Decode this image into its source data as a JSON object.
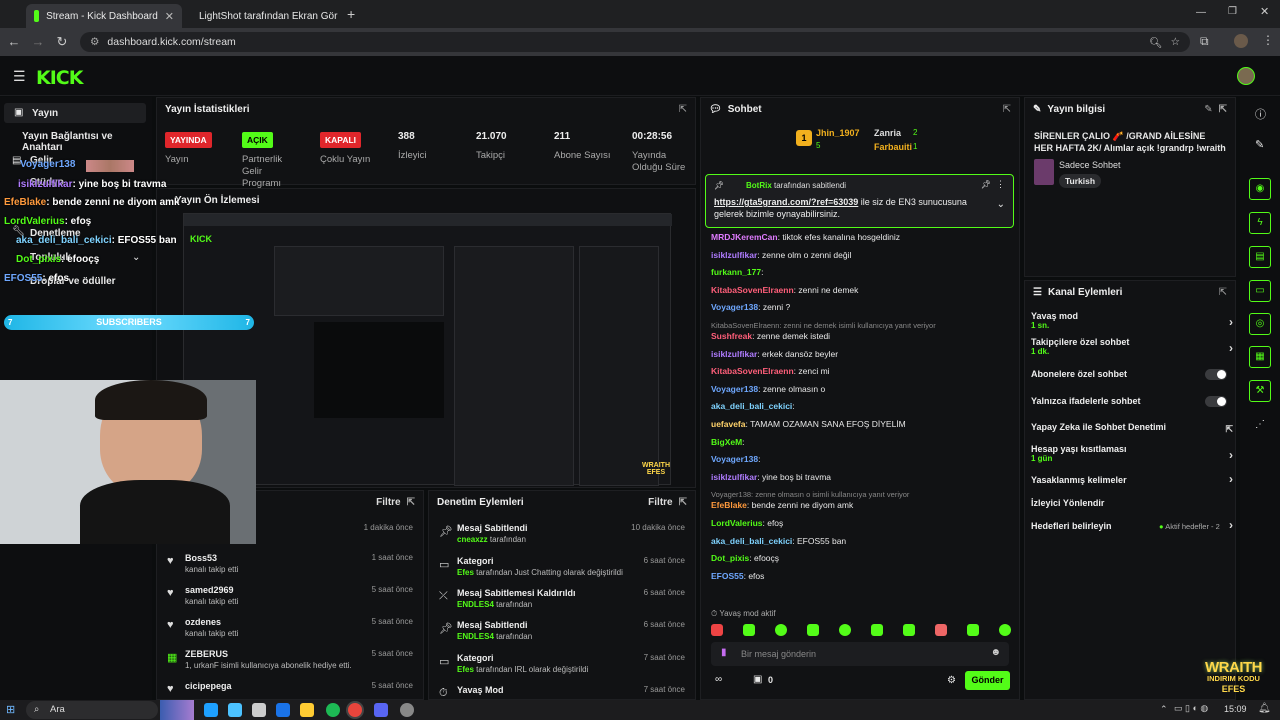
{
  "browser": {
    "tabs": [
      {
        "label": "Stream - Kick Dashboard",
        "active": true
      },
      {
        "label": "LightShot tarafından Ekran Gör",
        "active": false
      }
    ],
    "url": "dashboard.kick.com/stream"
  },
  "colors": {
    "accent": "#53fc18",
    "live_red": "#e0262b",
    "panel_bg": "#111214"
  },
  "sidebar": {
    "items": [
      {
        "label": "Yayın",
        "icon": "video-icon"
      },
      {
        "label": "Yayın Bağlantısı ve Anahtarı",
        "icon": "key-icon"
      },
      {
        "label": "Gelir",
        "icon": "money-icon"
      },
      {
        "label": "Stüdyo",
        "icon": "studio-icon"
      },
      {
        "label": "Denetleme",
        "icon": "shield-icon"
      },
      {
        "label": "Topluluk",
        "icon": "people-icon"
      },
      {
        "label": "Droplar ve ödüller",
        "icon": "gift-icon"
      }
    ]
  },
  "overlay": {
    "chat": [
      {
        "user": "Voyager138",
        "msg": ""
      },
      {
        "user": "isiklzulfikar",
        "msg": ": yine boş bi travma"
      },
      {
        "user": "EfeBlake",
        "msg": ": bende zenni ne diyom amk"
      },
      {
        "user": "LordValerius",
        "msg": ": efoş"
      },
      {
        "user": "aka_deli_bali_cekici",
        "msg": ": EFOS55 ban"
      },
      {
        "user": "Dot_pixis",
        "msg": ": efooçş"
      },
      {
        "user": "EFOS55",
        "msg": ": efos"
      }
    ],
    "subscribers_label": "SUBSCRIBERS",
    "sub_left": "7",
    "sub_right": "7",
    "brand_top": "WRAITH",
    "brand_bottom": "INDIRIM KODU",
    "brand_code": "EFES"
  },
  "stats": {
    "title": "Yayın İstatistikleri",
    "items": [
      {
        "badge": "YAYINDA",
        "label": "Yayın"
      },
      {
        "badge": "AÇIK",
        "label": "Partnerlik Gelir Programı"
      },
      {
        "badge": "KAPALI",
        "label": "Çoklu Yayın"
      },
      {
        "value": "388",
        "label": "İzleyici"
      },
      {
        "value": "21.070",
        "label": "Takipçi"
      },
      {
        "value": "211",
        "label": "Abone Sayısı"
      },
      {
        "value": "00:28:56",
        "label": "Yayında Olduğu Süre"
      }
    ]
  },
  "preview": {
    "title": "Yayın Ön İzlemesi"
  },
  "activity": {
    "filter_label": "Filtre",
    "top_time": "1 dakika önce",
    "rows": [
      {
        "user": "Boss53",
        "desc": "kanalı takip etti",
        "time": "1 saat önce",
        "icon": "heart-icon"
      },
      {
        "user": "samed2969",
        "desc": "kanalı takip etti",
        "time": "5 saat önce",
        "icon": "heart-icon"
      },
      {
        "user": "ozdenes",
        "desc": "kanalı takip etti",
        "time": "5 saat önce",
        "icon": "heart-icon"
      },
      {
        "user": "ZEBERUS",
        "desc": "1, urkanF isimli kullanıcıya abonelik hediye etti.",
        "time": "5 saat önce",
        "icon": "sub-icon"
      },
      {
        "user": "cicipepega",
        "desc": "",
        "time": "5 saat önce",
        "icon": "heart-icon"
      }
    ]
  },
  "modlog": {
    "title": "Denetim Eylemleri",
    "filter_label": "Filtre",
    "rows": [
      {
        "title": "Mesaj Sabitlendi",
        "user": "cneaxzz",
        "rest": " tarafından",
        "time": "10 dakika önce",
        "icon": "pin-icon"
      },
      {
        "title": "Kategori",
        "user": "Efes",
        "rest": " tarafından Just Chatting olarak değiştirildi",
        "time": "6 saat önce",
        "icon": "category-icon"
      },
      {
        "title": "Mesaj Sabitlemesi Kaldırıldı",
        "user": "ENDLES4",
        "rest": " tarafından",
        "time": "6 saat önce",
        "icon": "unpin-icon"
      },
      {
        "title": "Mesaj Sabitlendi",
        "user": "ENDLES4",
        "rest": " tarafından",
        "time": "6 saat önce",
        "icon": "pin-icon"
      },
      {
        "title": "Kategori",
        "user": "Efes",
        "rest": " tarafından IRL olarak değiştirildi",
        "time": "7 saat önce",
        "icon": "category-icon"
      },
      {
        "title": "Yavaş Mod",
        "user": "",
        "rest": "",
        "time": "7 saat önce",
        "icon": "slow-icon"
      }
    ]
  },
  "chat": {
    "title": "Sohbet",
    "top_gifters": [
      {
        "name": "Jhin_1907",
        "count": "5"
      },
      {
        "name": "Zanria",
        "count": "2"
      },
      {
        "name": "Farbauiti",
        "count": "1"
      }
    ],
    "pinned_by": "BotRix",
    "pinned_by_suffix": " tarafından sabitlendi",
    "pinned_link": "https://gta5grand.com/?ref=63039",
    "pinned_text": " ile siz de EN3 sunucusuna gelerek bizimle oynayabilirsiniz.",
    "messages": [
      {
        "user": "MRDJKeremCan",
        "color": "#e07cff",
        "text": ": tiktok efes kanalına hosgeldiniz"
      },
      {
        "user": "isiklzulfikar",
        "color": "#b07cff",
        "text": ": zenne olm o zenni değil"
      },
      {
        "user": "furkann_177",
        "color": "#53fc18",
        "text": ":"
      },
      {
        "user": "KitabaSovenElraenn",
        "color": "#ff5f7a",
        "text": ": zenni ne demek"
      },
      {
        "user": "Voyager138",
        "color": "#6fa8ff",
        "text": ": zenni ?"
      },
      {
        "reply": "KitabaSovenElraenn: zenni ne demek isimli kullanıcıya yanıt veriyor"
      },
      {
        "user": "Sushfreak",
        "color": "#ff5f7a",
        "text": ": zenne demek istedi"
      },
      {
        "user": "isiklzulfikar",
        "color": "#b07cff",
        "text": ": erkek dansöz beyler"
      },
      {
        "user": "KitabaSovenElraenn",
        "color": "#ff5f7a",
        "text": ": zenci mi"
      },
      {
        "user": "Voyager138",
        "color": "#6fa8ff",
        "text": ": zenne olmasın o"
      },
      {
        "user": "aka_deli_bali_cekici",
        "color": "#7fd3ff",
        "text": ":"
      },
      {
        "user": "uefavefa",
        "color": "#ffd36b",
        "text": ": TAMAM OZAMAN SANA EFOŞ DİYELİM"
      },
      {
        "user": "BigXeM",
        "color": "#53fc18",
        "text": ":"
      },
      {
        "user": "Voyager138",
        "color": "#6fa8ff",
        "text": ":"
      },
      {
        "user": "isiklzulfikar",
        "color": "#b07cff",
        "text": ": yine boş bi travma"
      },
      {
        "reply": "Voyager138: zenne olmasın o isimli kullanıcıya yanıt veriyor"
      },
      {
        "user": "EfeBlake",
        "color": "#ff9a3d",
        "text": ": bende zenni ne diyom amk"
      },
      {
        "user": "LordValerius",
        "color": "#53fc18",
        "text": ": efoş"
      },
      {
        "user": "aka_deli_bali_cekici",
        "color": "#7fd3ff",
        "text": ": EFOS55 ban"
      },
      {
        "user": "Dot_pixis",
        "color": "#53fc18",
        "text": ": efooçş"
      },
      {
        "user": "EFOS55",
        "color": "#6fa8ff",
        "text": ": efos"
      }
    ],
    "slow_mode": "Yavaş mod aktif",
    "input_placeholder": "Bir mesaj gönderin",
    "points": "0",
    "send_label": "Gönder"
  },
  "stream_info": {
    "title": "Yayın bilgisi",
    "stream_title": "SİRENLER ÇALIO 🧨 /GRAND AİLESİNE HER HAFTA 2K/ Alımlar açık !grandrp !wraith",
    "category": "Sadece Sohbet",
    "tag": "Turkish"
  },
  "channel_actions": {
    "title": "Kanal Eylemleri",
    "items": [
      {
        "label": "Yavaş mod",
        "sub": "1 sn.",
        "control": "chevron"
      },
      {
        "label": "Takipçilere özel sohbet",
        "sub": "1 dk.",
        "control": "chevron"
      },
      {
        "label": "Abonelere özel sohbet",
        "sub": "",
        "control": "toggle"
      },
      {
        "label": "Yalnızca ifadelerle sohbet",
        "sub": "",
        "control": "toggle"
      },
      {
        "label": "Yapay Zeka ile Sohbet Denetimi",
        "sub": "",
        "control": "external"
      },
      {
        "label": "Hesap yaşı kısıtlaması",
        "sub": "1 gün",
        "control": "chevron"
      },
      {
        "label": "Yasaklanmış kelimeler",
        "sub": "",
        "control": "chevron"
      },
      {
        "label": "İzleyici Yönlendir",
        "sub": "",
        "control": "none"
      },
      {
        "label": "Hedefleri belirleyin",
        "sub": "",
        "control": "chevron",
        "status": "Aktif hedefler - 2"
      }
    ]
  },
  "taskbar": {
    "search": "Ara",
    "time": "15:09"
  }
}
